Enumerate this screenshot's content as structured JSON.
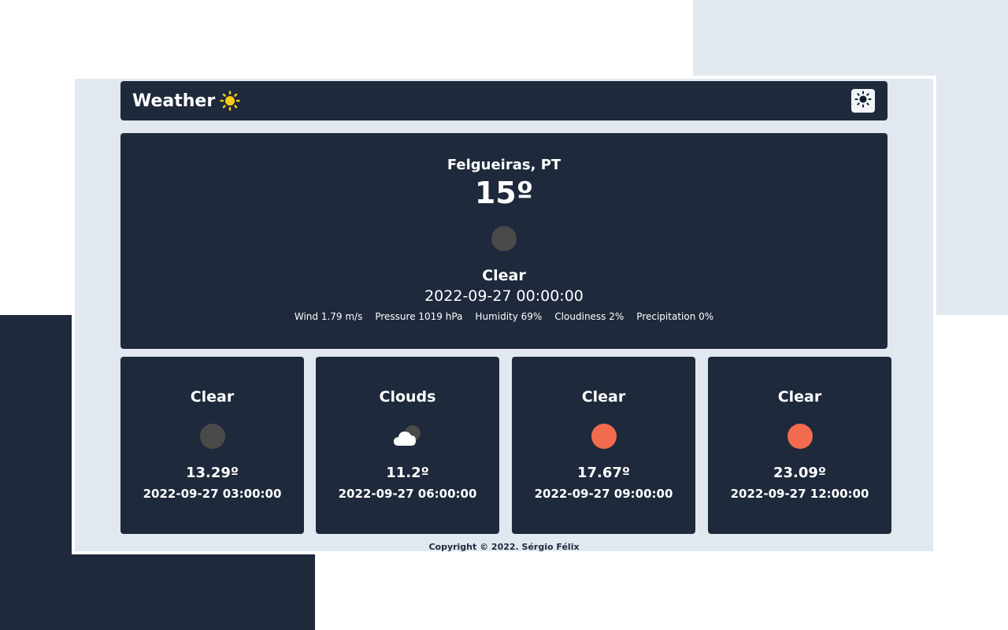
{
  "header": {
    "title": "Weather",
    "title_icon": "sun-icon",
    "theme_toggle_icon": "sun-icon"
  },
  "current": {
    "location": "Felgueiras, PT",
    "temperature": "15º",
    "icon": "moon-icon",
    "condition": "Clear",
    "datetime": "2022-09-27 00:00:00",
    "stats": [
      "Wind 1.79 m/s",
      "Pressure 1019 hPa",
      "Humidity 69%",
      "Cloudiness 2%",
      "Precipitation 0%"
    ]
  },
  "forecast": [
    {
      "condition": "Clear",
      "icon": "moon-icon",
      "temperature": "13.29º",
      "datetime": "2022-09-27 03:00:00"
    },
    {
      "condition": "Clouds",
      "icon": "cloud-moon-icon",
      "temperature": "11.2º",
      "datetime": "2022-09-27 06:00:00"
    },
    {
      "condition": "Clear",
      "icon": "sun-icon",
      "temperature": "17.67º",
      "datetime": "2022-09-27 09:00:00"
    },
    {
      "condition": "Clear",
      "icon": "sun-icon",
      "temperature": "23.09º",
      "datetime": "2022-09-27 12:00:00"
    }
  ],
  "footer": {
    "copyright": "Copyright © 2022. Sérgio Félix"
  },
  "colors": {
    "dark_panel": "#1e293b",
    "light_background": "#e2e8f0",
    "sun": "#f26b4e",
    "moon": "#4a4a4a",
    "brand_sun": "#facc15"
  }
}
